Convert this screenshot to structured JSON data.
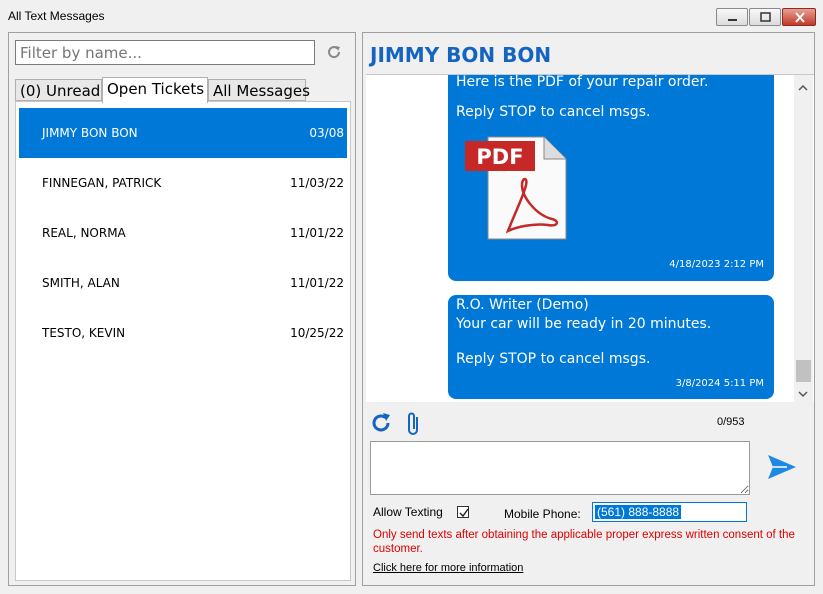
{
  "window": {
    "title": "All Text Messages",
    "buttons": {
      "minimize": "minimize-icon",
      "maximize": "maximize-icon",
      "close": "close-icon"
    }
  },
  "left": {
    "filter_placeholder": "Filter by name...",
    "tabs": [
      {
        "label": "(0) Unread"
      },
      {
        "label": "Open Tickets"
      },
      {
        "label": "All Messages"
      }
    ],
    "selected_tab": "Open Tickets",
    "contacts": [
      {
        "name": "JIMMY BON BON",
        "date": "03/08"
      },
      {
        "name": "FINNEGAN, PATRICK",
        "date": "11/03/22"
      },
      {
        "name": "REAL, NORMA",
        "date": "11/01/22"
      },
      {
        "name": "SMITH, ALAN",
        "date": "11/01/22"
      },
      {
        "name": "TESTO, KEVIN",
        "date": "10/25/22"
      }
    ]
  },
  "right": {
    "contact_name": "JIMMY BON BON",
    "messages": [
      {
        "line1": "Here is the PDF of your repair order.",
        "line2": "Reply STOP to cancel msgs.",
        "attachment": "PDF",
        "time": "4/18/2023 2:12 PM"
      },
      {
        "sender": "R.O. Writer (Demo)",
        "line1": "Your car will be ready in 20 minutes.",
        "line2": "Reply STOP to cancel msgs.",
        "time": "3/8/2024 5:11 PM"
      }
    ],
    "char_counter": "0/953",
    "allow_texting_label": "Allow Texting",
    "allow_texting_checked": true,
    "mobile_phone_label": "Mobile Phone:",
    "mobile_phone_value": "(561) 888-8888",
    "consent_text": "Only send texts after obtaining the applicable proper express written consent of the customer.",
    "info_link": "Click here for more information"
  },
  "colors": {
    "accent": "#0078d7",
    "title_blue": "#1565c0",
    "warning_red": "#e00000"
  }
}
